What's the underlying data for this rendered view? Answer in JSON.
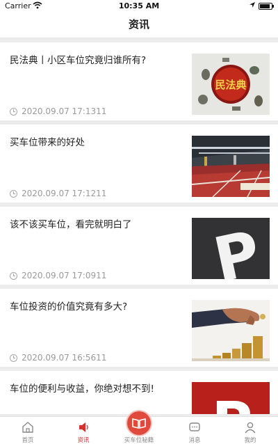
{
  "status_bar": {
    "carrier": "Carrier",
    "time": "10:35 AM",
    "battery_level": 0.9
  },
  "header": {
    "title": "资讯"
  },
  "articles": [
    {
      "title": "民法典丨小区车位究竟归谁所有?",
      "timestamp": "2020.09.07 17:1311",
      "thumb_text": "民法典"
    },
    {
      "title": "买车位带来的好处",
      "timestamp": "2020.09.07 17:1211"
    },
    {
      "title": "该不该买车位，看完就明白了",
      "timestamp": "2020.09.07 17:0911",
      "thumb_text": "P"
    },
    {
      "title": "车位投资的价值究竟有多大?",
      "timestamp": "2020.09.07 16:5611"
    },
    {
      "title": "车位的便利与收益，你绝对想不到!",
      "timestamp": "",
      "thumb_text": "P"
    }
  ],
  "tab_bar": {
    "tabs": [
      {
        "label": "首页",
        "icon": "home-icon",
        "active": false
      },
      {
        "label": "资讯",
        "icon": "speaker-icon",
        "active": true
      },
      {
        "label": "买车位秘籍",
        "icon": "book-icon",
        "active": false
      },
      {
        "label": "消息",
        "icon": "message-icon",
        "active": false
      },
      {
        "label": "我的",
        "icon": "person-icon",
        "active": false
      }
    ]
  },
  "colors": {
    "accent": "#d8302b",
    "background": "#ececec",
    "card": "#ffffff",
    "muted_text": "#9a9a9a"
  }
}
